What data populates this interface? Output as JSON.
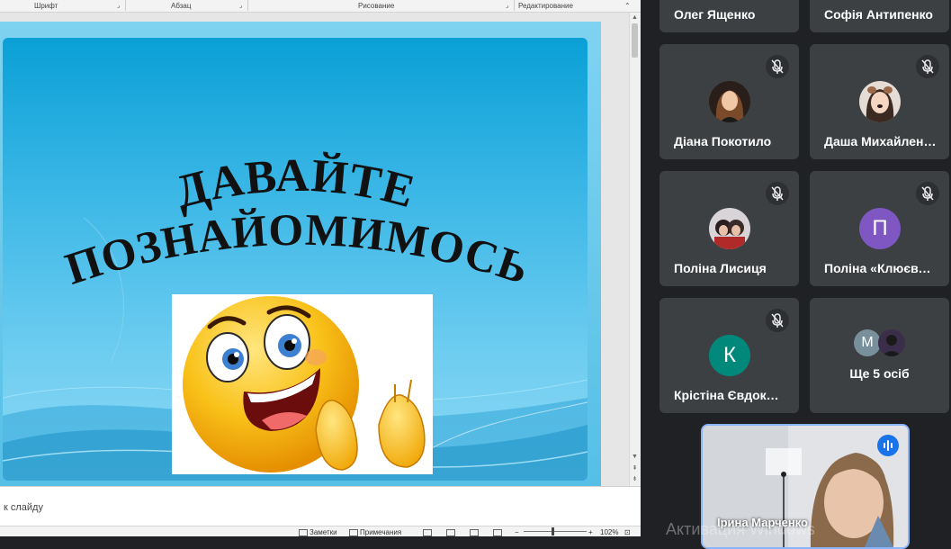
{
  "ribbon": {
    "groups": [
      "Шрифт",
      "Абзац",
      "Рисование",
      "Редактирование"
    ]
  },
  "slide": {
    "title_line1": "ДАВАЙТЕ",
    "title_line2": "ПОЗНАЙОМИМОСЬ"
  },
  "notes": {
    "placeholder": "к слайду"
  },
  "statusbar": {
    "notes_label": "Заметки",
    "comments_label": "Примечания",
    "zoom": "102%"
  },
  "meet": {
    "participants": [
      {
        "name": "Олег Ященко"
      },
      {
        "name": "Софія Антипенко"
      },
      {
        "name": "Діана Покотило",
        "muted": true
      },
      {
        "name": "Даша Михайлен…",
        "muted": true
      },
      {
        "name": "Поліна Лисиця",
        "muted": true
      },
      {
        "name": "Поліна «Клюєва…",
        "muted": true,
        "avatar_letter": "П",
        "avatar_color": "#7e57c2"
      },
      {
        "name": "Крістіна Євдоки…",
        "muted": true,
        "avatar_letter": "К",
        "avatar_color": "#00897b"
      },
      {
        "name": "Ще 5 осіб",
        "avatar_letter": "М",
        "avatar_color": "#78909c"
      }
    ],
    "self": {
      "name": "Ірина Марченко"
    }
  },
  "watermark": "Активация Windows",
  "colors": {
    "meet_bg": "#202124",
    "tile_bg": "#3c4043",
    "speaking": "#1a73e8"
  }
}
